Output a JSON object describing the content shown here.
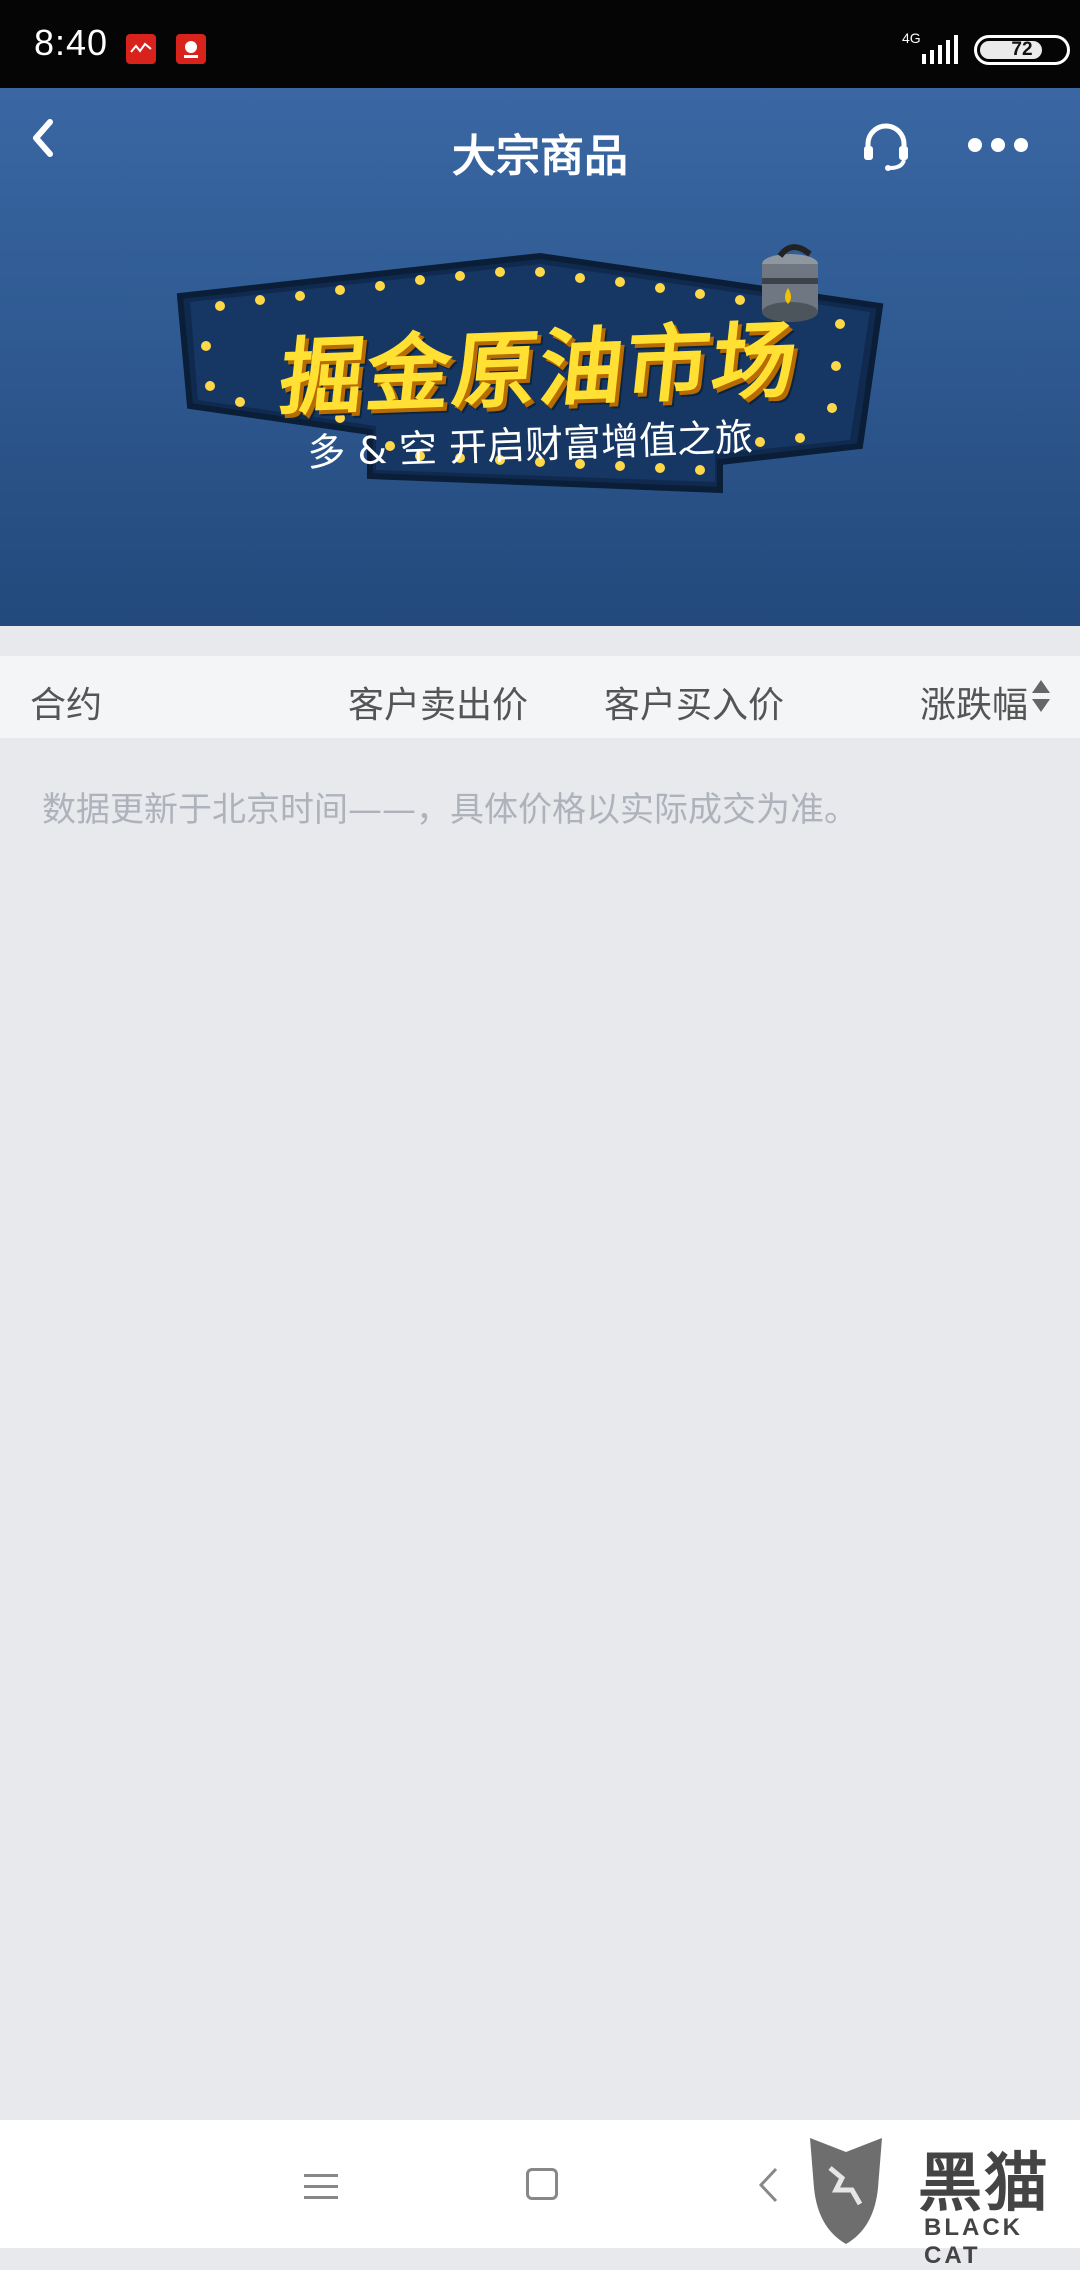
{
  "status_bar": {
    "time": "8:40",
    "network": "4G",
    "battery": "72"
  },
  "header": {
    "title": "大宗商品",
    "back_icon": "chevron-left-icon",
    "support_icon": "headset-icon",
    "more_icon": "more-dots-icon"
  },
  "banner": {
    "title": "掘金原油市场",
    "subtitle": "多 & 空  开启财富增值之旅"
  },
  "table": {
    "columns": [
      "合约",
      "客户卖出价",
      "客户买入价",
      "涨跌幅"
    ]
  },
  "notice": "数据更新于北京时间——，具体价格以实际成交为准。",
  "watermark": {
    "text": "黑猫",
    "sub": "BLACK CAT"
  },
  "colors": {
    "header_bg": "#2f5a92",
    "banner_accent": "#ffe033",
    "page_bg": "#e8e9ed"
  }
}
